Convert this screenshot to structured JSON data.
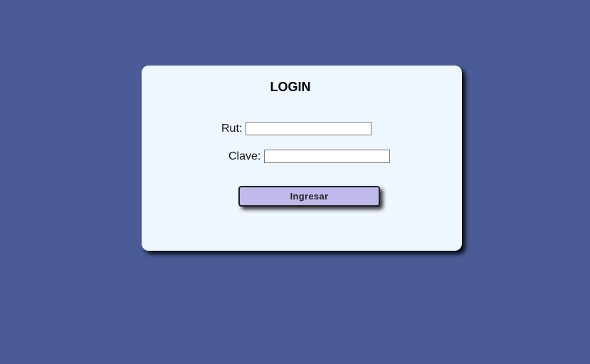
{
  "page": {
    "background_color": "#4b5b97"
  },
  "login": {
    "title": "LOGIN",
    "card_color": "#eef7ff",
    "rut": {
      "label": "Rut:",
      "value": ""
    },
    "clave": {
      "label": "Clave:",
      "value": ""
    },
    "submit": {
      "label": "Ingresar",
      "color": "#c0b9ec"
    }
  }
}
